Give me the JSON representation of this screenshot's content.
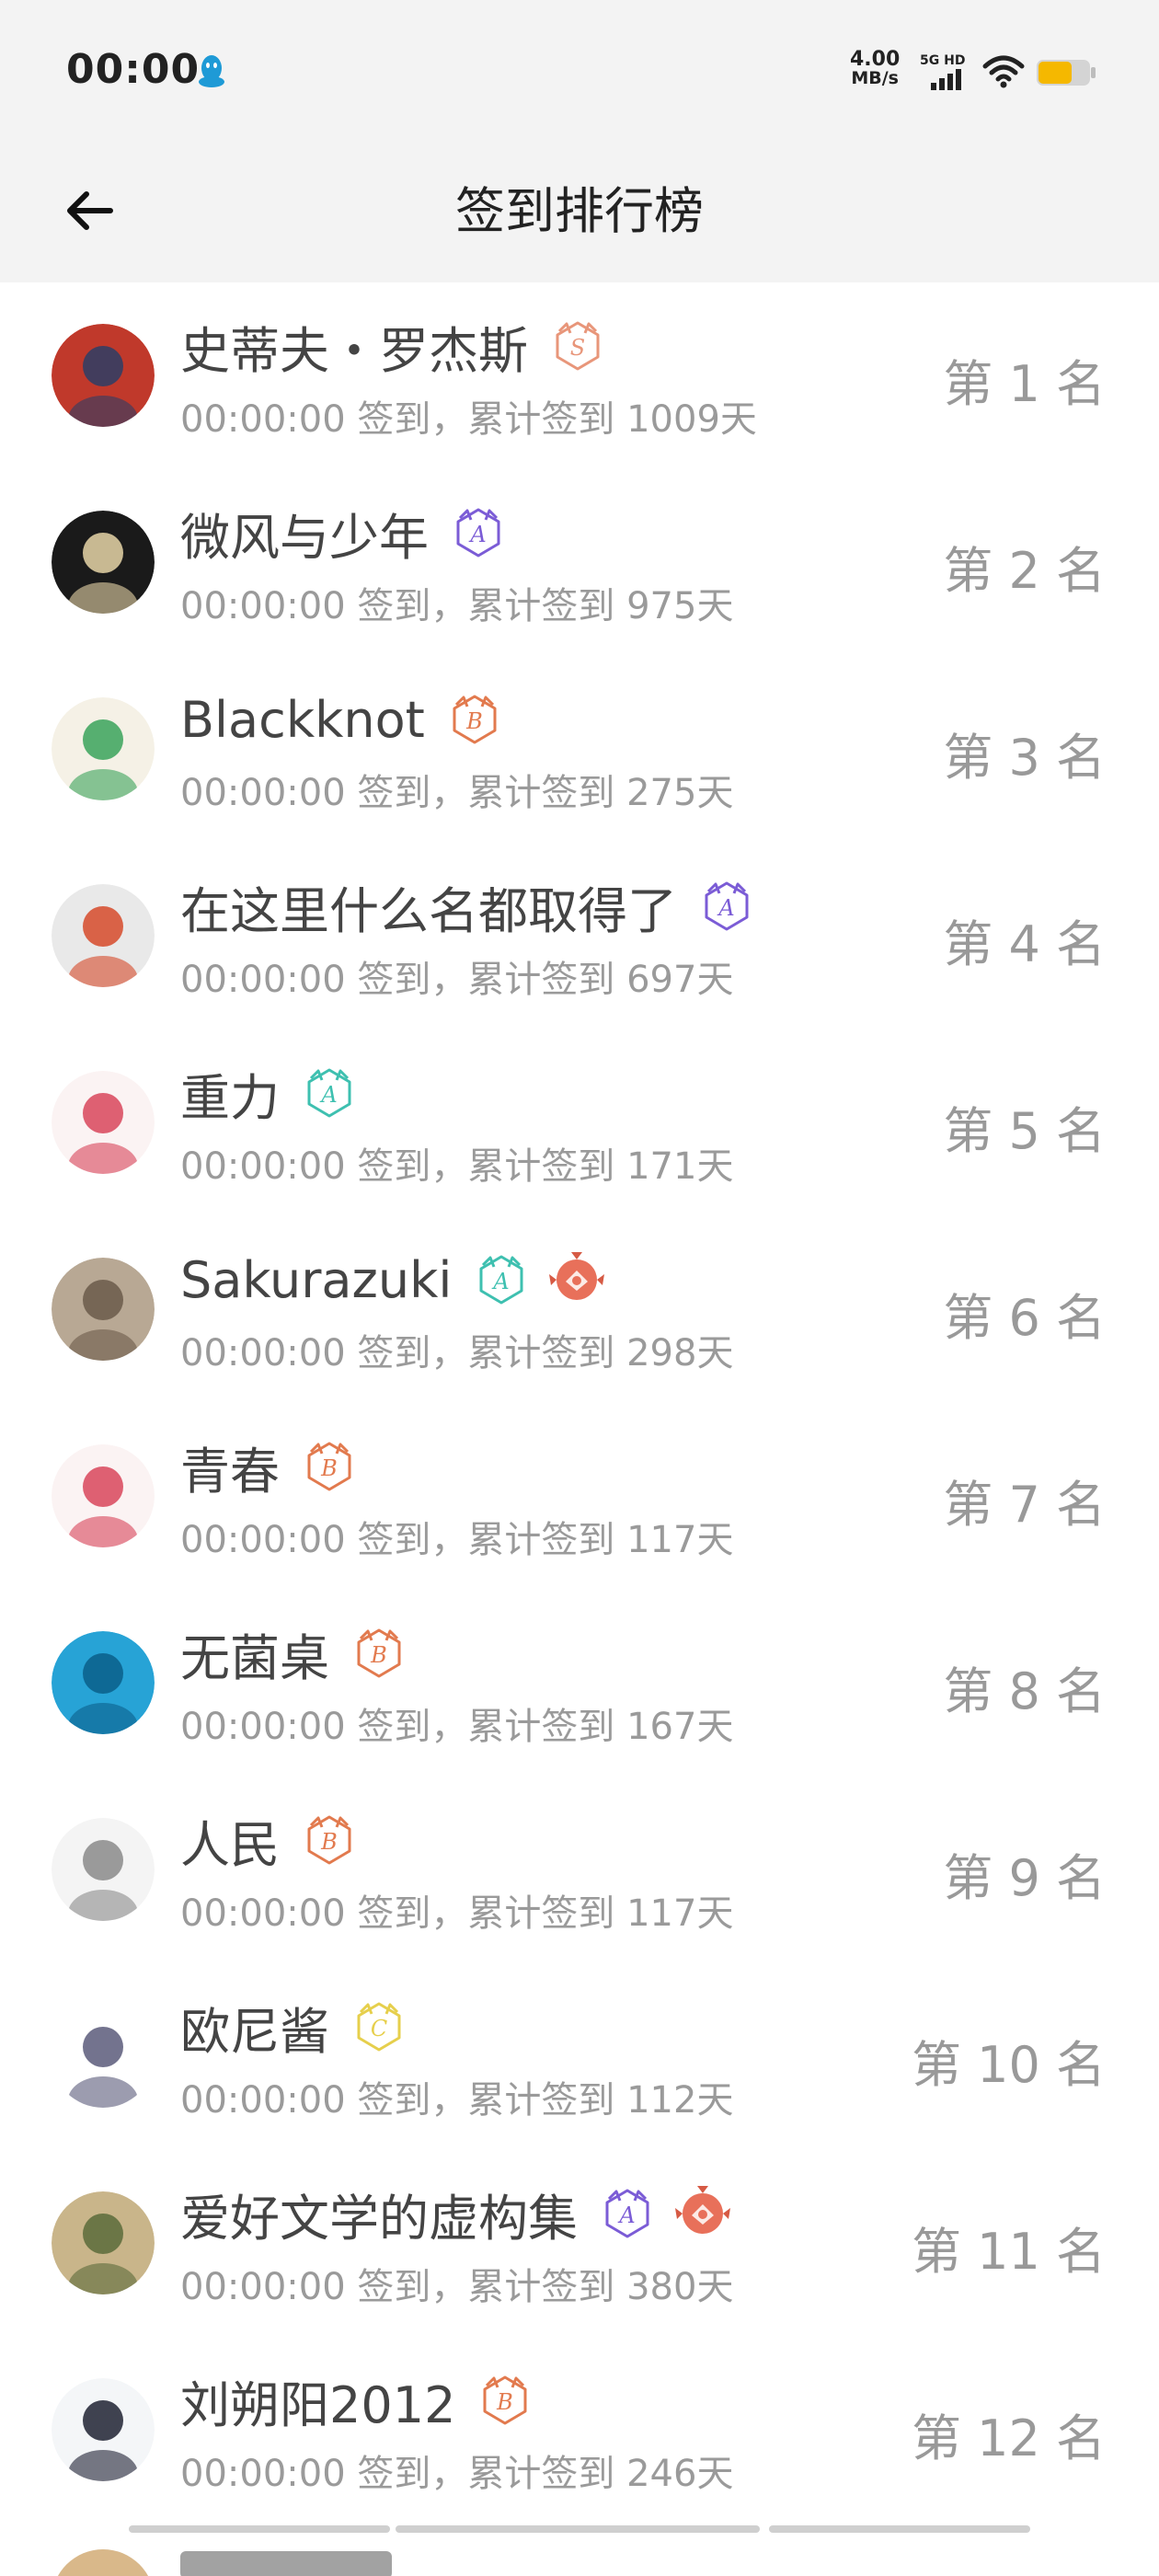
{
  "status_bar": {
    "time": "00:00",
    "net_speed_value": "4.00",
    "net_speed_unit": "MB/s",
    "network": "5G HD",
    "battery_color": "#f5b800"
  },
  "header": {
    "title": "签到排行榜",
    "back_icon": "arrow-left-icon"
  },
  "rank_list": [
    {
      "name": "史蒂夫・罗杰斯",
      "time": "00:00:00",
      "checkin_text": "签到，累计签到",
      "days": "1009天",
      "rank_label": "第 1 名",
      "badge_letter": "S",
      "badge_color": "#e8967a",
      "medal": false,
      "avatar_colors": [
        "#c0392b",
        "#2c3e66"
      ]
    },
    {
      "name": "微风与少年",
      "time": "00:00:00",
      "checkin_text": "签到，累计签到",
      "days": "975天",
      "rank_label": "第 2 名",
      "badge_letter": "A",
      "badge_color": "#7b5cd6",
      "medal": false,
      "avatar_colors": [
        "#1a1a1a",
        "#e8d6a8"
      ]
    },
    {
      "name": "Blackknot",
      "time": "00:00:00",
      "checkin_text": "签到，累计签到",
      "days": "275天",
      "rank_label": "第 3 名",
      "badge_letter": "B",
      "badge_color": "#e27a4e",
      "medal": false,
      "avatar_colors": [
        "#f5f1e6",
        "#3aa35a"
      ]
    },
    {
      "name": "在这里什么名都取得了",
      "time": "00:00:00",
      "checkin_text": "签到，累计签到",
      "days": "697天",
      "rank_label": "第 4 名",
      "badge_letter": "A",
      "badge_color": "#7b5cd6",
      "medal": false,
      "avatar_colors": [
        "#e9e9e9",
        "#d64a2a"
      ]
    },
    {
      "name": "重力",
      "time": "00:00:00",
      "checkin_text": "签到，累计签到",
      "days": "171天",
      "rank_label": "第 5 名",
      "badge_letter": "A",
      "badge_color": "#3ec0b0",
      "medal": false,
      "avatar_colors": [
        "#fbf3f3",
        "#d8455a"
      ]
    },
    {
      "name": "Sakurazuki",
      "time": "00:00:00",
      "checkin_text": "签到，累计签到",
      "days": "298天",
      "rank_label": "第 6 名",
      "badge_letter": "A",
      "badge_color": "#3ec0b0",
      "medal": true,
      "avatar_colors": [
        "#b8a894",
        "#6a5a4a"
      ]
    },
    {
      "name": "青春",
      "time": "00:00:00",
      "checkin_text": "签到，累计签到",
      "days": "117天",
      "rank_label": "第 7 名",
      "badge_letter": "B",
      "badge_color": "#e27a4e",
      "medal": false,
      "avatar_colors": [
        "#fbf3f3",
        "#d8455a"
      ]
    },
    {
      "name": "无菌桌",
      "time": "00:00:00",
      "checkin_text": "签到，累计签到",
      "days": "167天",
      "rank_label": "第 8 名",
      "badge_letter": "B",
      "badge_color": "#e27a4e",
      "medal": false,
      "avatar_colors": [
        "#27a3d6",
        "#0b5f8a"
      ]
    },
    {
      "name": "人民",
      "time": "00:00:00",
      "checkin_text": "签到，累计签到",
      "days": "117天",
      "rank_label": "第 9 名",
      "badge_letter": "B",
      "badge_color": "#e27a4e",
      "medal": false,
      "avatar_colors": [
        "#f4f4f4",
        "#8a8a8a"
      ]
    },
    {
      "name": "欧尼酱",
      "time": "00:00:00",
      "checkin_text": "签到，累计签到",
      "days": "112天",
      "rank_label": "第 10 名",
      "badge_letter": "C",
      "badge_color": "#e6cf4c",
      "medal": false,
      "avatar_colors": [
        "#ffffff",
        "#5a5a7a"
      ]
    },
    {
      "name": "爱好文学的虚构集",
      "time": "00:00:00",
      "checkin_text": "签到，累计签到",
      "days": "380天",
      "rank_label": "第 11 名",
      "badge_letter": "A",
      "badge_color": "#7b5cd6",
      "medal": true,
      "avatar_colors": [
        "#c9b58a",
        "#5b6b3a"
      ]
    },
    {
      "name": "刘朔阳2012",
      "time": "00:00:00",
      "checkin_text": "签到，累计签到",
      "days": "246天",
      "rank_label": "第 12 名",
      "badge_letter": "B",
      "badge_color": "#e27a4e",
      "medal": false,
      "avatar_colors": [
        "#f4f6f8",
        "#1e2233"
      ]
    }
  ]
}
